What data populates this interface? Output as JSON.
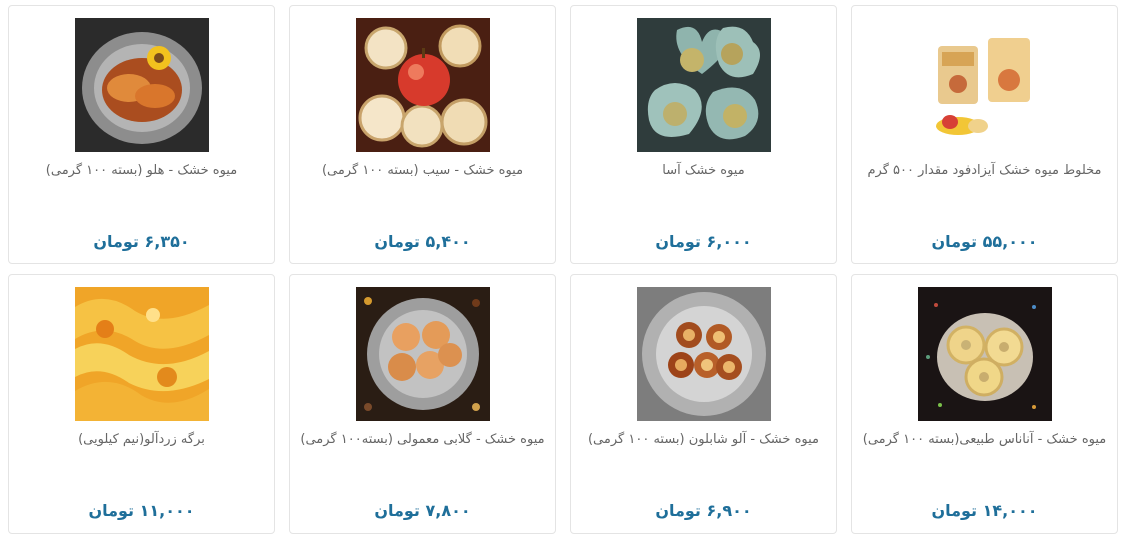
{
  "products": [
    {
      "name": "مخلوط میوه خشک آیزادفود مقدار ۵۰۰ گرم",
      "price": "۵۵,۰۰۰ تومان"
    },
    {
      "name": "میوه خشک آسا",
      "price": "۶,۰۰۰ تومان"
    },
    {
      "name": "میوه خشک - سیب (بسته ۱۰۰ گرمی)",
      "price": "۵,۴۰۰ تومان"
    },
    {
      "name": "میوه خشک - هلو (بسته ۱۰۰ گرمی)",
      "price": "۶,۳۵۰ تومان"
    },
    {
      "name": "میوه خشک - آناناس طبیعی(بسته ۱۰۰ گرمی)",
      "price": "۱۴,۰۰۰ تومان"
    },
    {
      "name": "میوه خشک - آلو شابلون (بسته ۱۰۰ گرمی)",
      "price": "۶,۹۰۰ تومان"
    },
    {
      "name": "میوه خشک - گلابی معمولی (بسته۱۰۰ گرمی)",
      "price": "۷,۸۰۰ تومان"
    },
    {
      "name": "برگه زردآلو(نیم کیلویی)",
      "price": "۱۱,۰۰۰ تومان"
    }
  ]
}
